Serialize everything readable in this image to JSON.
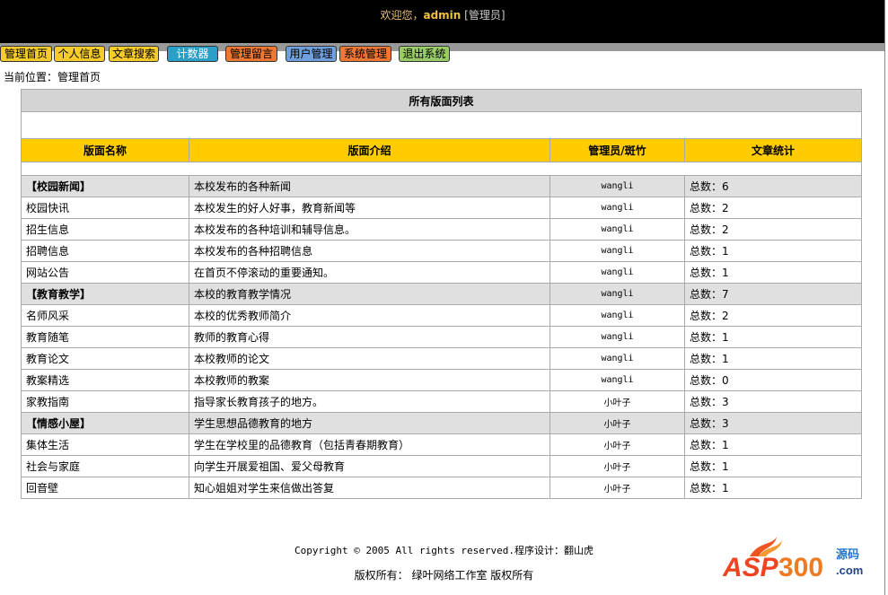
{
  "header": {
    "welcome": "欢迎您，",
    "user": "admin",
    "role": "[管理员]"
  },
  "nav": [
    {
      "label": "管理首页",
      "color": "#f5cc2a"
    },
    {
      "label": "个人信息",
      "color": "#f5cc2a"
    },
    {
      "label": "文章搜索",
      "color": "#f5cc2a"
    },
    {
      "label": "计数器",
      "color": "#2a9fc8"
    },
    {
      "label": "管理留言",
      "color": "#ee7733"
    },
    {
      "label": "用户管理",
      "color": "#6fa0dd"
    },
    {
      "label": "系统管理",
      "color": "#ee7733"
    },
    {
      "label": "退出系统",
      "color": "#99cc66"
    }
  ],
  "breadcrumb": "当前位置：管理首页",
  "table": {
    "title": "所有版面列表",
    "columns": [
      "版面名称",
      "版面介绍",
      "管理员/斑竹",
      "文章统计"
    ],
    "rows": [
      {
        "name": "【校园新闻】",
        "desc": "本校发布的各种新闻",
        "admin": "wangli",
        "count": "总数：6",
        "category": true
      },
      {
        "name": "校园快讯",
        "desc": "本校发生的好人好事，教育新闻等",
        "admin": "wangli",
        "count": "总数：2"
      },
      {
        "name": "招生信息",
        "desc": "本校发布的各种培训和辅导信息。",
        "admin": "wangli",
        "count": "总数：2"
      },
      {
        "name": "招聘信息",
        "desc": "本校发布的各种招聘信息",
        "admin": "wangli",
        "count": "总数：1"
      },
      {
        "name": "网站公告",
        "desc": "在首页不停滚动的重要通知。",
        "admin": "wangli",
        "count": "总数：1"
      },
      {
        "name": "【教育教学】",
        "desc": "本校的教育教学情况",
        "admin": "wangli",
        "count": "总数：7",
        "category": true
      },
      {
        "name": "名师风采",
        "desc": "本校的优秀教师简介",
        "admin": "wangli",
        "count": "总数：2"
      },
      {
        "name": "教育随笔",
        "desc": "教师的教育心得",
        "admin": "wangli",
        "count": "总数：1"
      },
      {
        "name": "教育论文",
        "desc": "本校教师的论文",
        "admin": "wangli",
        "count": "总数：1"
      },
      {
        "name": "教案精选",
        "desc": "本校教师的教案",
        "admin": "wangli",
        "count": "总数：0"
      },
      {
        "name": "家教指南",
        "desc": "指导家长教育孩子的地方。",
        "admin": "小叶子",
        "count": "总数：3"
      },
      {
        "name": "【情感小屋】",
        "desc": "学生思想品德教育的地方",
        "admin": "小叶子",
        "count": "总数：3",
        "category": true
      },
      {
        "name": "集体生活",
        "desc": "学生在学校里的品德教育（包括青春期教育）",
        "admin": "小叶子",
        "count": "总数：1"
      },
      {
        "name": "社会与家庭",
        "desc": "向学生开展爱祖国、爱父母教育",
        "admin": "小叶子",
        "count": "总数：1"
      },
      {
        "name": "回音壁",
        "desc": "知心姐姐对学生来信做出答复",
        "admin": "小叶子",
        "count": "总数：1"
      }
    ]
  },
  "footer": {
    "copyright": "Copyright © 2005 All rights reserved.程序设计：翻山虎",
    "owner": "版权所有： 绿叶网络工作室  版权所有"
  },
  "logo": {
    "text": "ASP300",
    "sub": "源码",
    ".com": ".com"
  }
}
